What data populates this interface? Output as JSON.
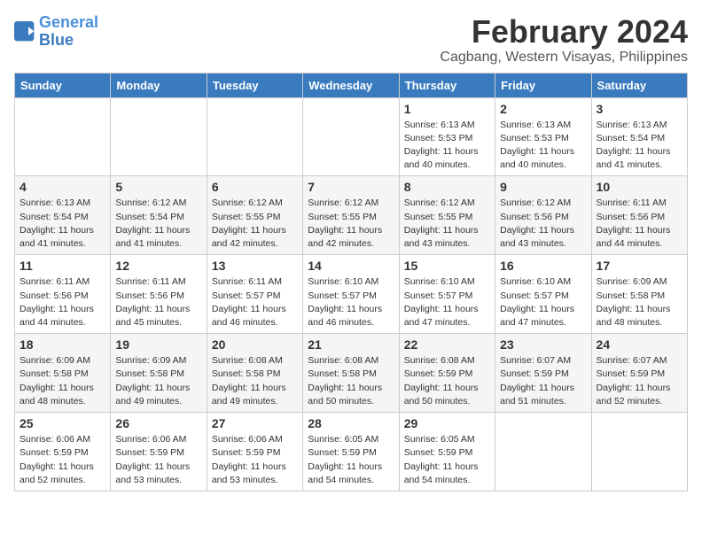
{
  "logo": {
    "line1": "General",
    "line2": "Blue"
  },
  "title": "February 2024",
  "location": "Cagbang, Western Visayas, Philippines",
  "headers": [
    "Sunday",
    "Monday",
    "Tuesday",
    "Wednesday",
    "Thursday",
    "Friday",
    "Saturday"
  ],
  "weeks": [
    [
      {
        "day": "",
        "info": ""
      },
      {
        "day": "",
        "info": ""
      },
      {
        "day": "",
        "info": ""
      },
      {
        "day": "",
        "info": ""
      },
      {
        "day": "1",
        "info": "Sunrise: 6:13 AM\nSunset: 5:53 PM\nDaylight: 11 hours and 40 minutes."
      },
      {
        "day": "2",
        "info": "Sunrise: 6:13 AM\nSunset: 5:53 PM\nDaylight: 11 hours and 40 minutes."
      },
      {
        "day": "3",
        "info": "Sunrise: 6:13 AM\nSunset: 5:54 PM\nDaylight: 11 hours and 41 minutes."
      }
    ],
    [
      {
        "day": "4",
        "info": "Sunrise: 6:13 AM\nSunset: 5:54 PM\nDaylight: 11 hours and 41 minutes."
      },
      {
        "day": "5",
        "info": "Sunrise: 6:12 AM\nSunset: 5:54 PM\nDaylight: 11 hours and 41 minutes."
      },
      {
        "day": "6",
        "info": "Sunrise: 6:12 AM\nSunset: 5:55 PM\nDaylight: 11 hours and 42 minutes."
      },
      {
        "day": "7",
        "info": "Sunrise: 6:12 AM\nSunset: 5:55 PM\nDaylight: 11 hours and 42 minutes."
      },
      {
        "day": "8",
        "info": "Sunrise: 6:12 AM\nSunset: 5:55 PM\nDaylight: 11 hours and 43 minutes."
      },
      {
        "day": "9",
        "info": "Sunrise: 6:12 AM\nSunset: 5:56 PM\nDaylight: 11 hours and 43 minutes."
      },
      {
        "day": "10",
        "info": "Sunrise: 6:11 AM\nSunset: 5:56 PM\nDaylight: 11 hours and 44 minutes."
      }
    ],
    [
      {
        "day": "11",
        "info": "Sunrise: 6:11 AM\nSunset: 5:56 PM\nDaylight: 11 hours and 44 minutes."
      },
      {
        "day": "12",
        "info": "Sunrise: 6:11 AM\nSunset: 5:56 PM\nDaylight: 11 hours and 45 minutes."
      },
      {
        "day": "13",
        "info": "Sunrise: 6:11 AM\nSunset: 5:57 PM\nDaylight: 11 hours and 46 minutes."
      },
      {
        "day": "14",
        "info": "Sunrise: 6:10 AM\nSunset: 5:57 PM\nDaylight: 11 hours and 46 minutes."
      },
      {
        "day": "15",
        "info": "Sunrise: 6:10 AM\nSunset: 5:57 PM\nDaylight: 11 hours and 47 minutes."
      },
      {
        "day": "16",
        "info": "Sunrise: 6:10 AM\nSunset: 5:57 PM\nDaylight: 11 hours and 47 minutes."
      },
      {
        "day": "17",
        "info": "Sunrise: 6:09 AM\nSunset: 5:58 PM\nDaylight: 11 hours and 48 minutes."
      }
    ],
    [
      {
        "day": "18",
        "info": "Sunrise: 6:09 AM\nSunset: 5:58 PM\nDaylight: 11 hours and 48 minutes."
      },
      {
        "day": "19",
        "info": "Sunrise: 6:09 AM\nSunset: 5:58 PM\nDaylight: 11 hours and 49 minutes."
      },
      {
        "day": "20",
        "info": "Sunrise: 6:08 AM\nSunset: 5:58 PM\nDaylight: 11 hours and 49 minutes."
      },
      {
        "day": "21",
        "info": "Sunrise: 6:08 AM\nSunset: 5:58 PM\nDaylight: 11 hours and 50 minutes."
      },
      {
        "day": "22",
        "info": "Sunrise: 6:08 AM\nSunset: 5:59 PM\nDaylight: 11 hours and 50 minutes."
      },
      {
        "day": "23",
        "info": "Sunrise: 6:07 AM\nSunset: 5:59 PM\nDaylight: 11 hours and 51 minutes."
      },
      {
        "day": "24",
        "info": "Sunrise: 6:07 AM\nSunset: 5:59 PM\nDaylight: 11 hours and 52 minutes."
      }
    ],
    [
      {
        "day": "25",
        "info": "Sunrise: 6:06 AM\nSunset: 5:59 PM\nDaylight: 11 hours and 52 minutes."
      },
      {
        "day": "26",
        "info": "Sunrise: 6:06 AM\nSunset: 5:59 PM\nDaylight: 11 hours and 53 minutes."
      },
      {
        "day": "27",
        "info": "Sunrise: 6:06 AM\nSunset: 5:59 PM\nDaylight: 11 hours and 53 minutes."
      },
      {
        "day": "28",
        "info": "Sunrise: 6:05 AM\nSunset: 5:59 PM\nDaylight: 11 hours and 54 minutes."
      },
      {
        "day": "29",
        "info": "Sunrise: 6:05 AM\nSunset: 5:59 PM\nDaylight: 11 hours and 54 minutes."
      },
      {
        "day": "",
        "info": ""
      },
      {
        "day": "",
        "info": ""
      }
    ]
  ]
}
